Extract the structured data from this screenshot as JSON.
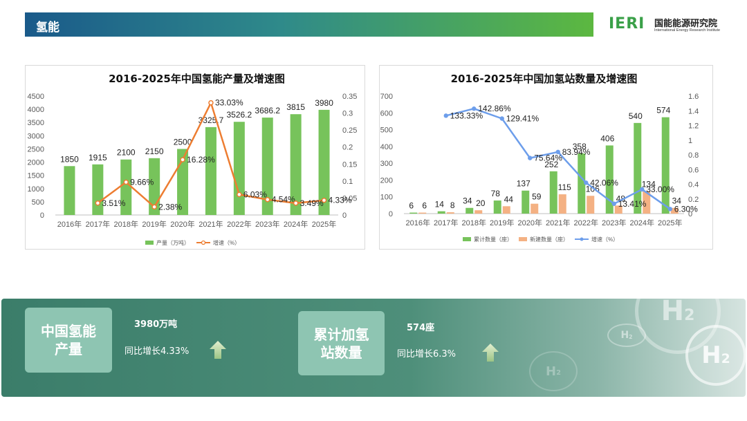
{
  "header": {
    "title": "氢能"
  },
  "logo": {
    "mark": "IERI",
    "name_cn": "国能能源研究院",
    "name_en": "International Energy Research Institute"
  },
  "colors": {
    "green": "#77c35b",
    "orange": "#ed7d31",
    "peach": "#f4b183",
    "blue": "#6d9eeb",
    "axis_text": "#595959",
    "grid": "#e6e6e6"
  },
  "chart_data": [
    {
      "type": "bar",
      "title": "2016-2025年中国氢能产量及增速图",
      "categories": [
        "2016年",
        "2017年",
        "2018年",
        "2019年",
        "2020年",
        "2021年",
        "2022年",
        "2023年",
        "2024年",
        "2025年"
      ],
      "series": [
        {
          "name": "产量（万吨）",
          "type": "bar",
          "axis": "left",
          "values": [
            1850,
            1915,
            2100,
            2150,
            2500,
            3325.7,
            3526.2,
            3686.2,
            3815,
            3980
          ],
          "labels": [
            "1850",
            "1915",
            "2100",
            "2150",
            "2500",
            "3325.7",
            "3526.2",
            "3686.2",
            "3815",
            "3980"
          ]
        },
        {
          "name": "增速（%）",
          "type": "line",
          "axis": "right",
          "values": [
            null,
            0.0351,
            0.0966,
            0.0238,
            0.1628,
            0.3303,
            0.0603,
            0.0454,
            0.0349,
            0.0433
          ],
          "labels": [
            "",
            "3.51%",
            "9.66%",
            "2.38%",
            "16.28%",
            "33.03%",
            "6.03%",
            "4.54%",
            "3.49%",
            "4.33%"
          ]
        }
      ],
      "ylim": [
        0,
        4500
      ],
      "y_ticks": [
        0,
        500,
        1000,
        1500,
        2000,
        2500,
        3000,
        3500,
        4000,
        4500
      ],
      "y2lim": [
        0,
        0.35
      ],
      "y2_ticks": [
        0,
        0.05,
        0.1,
        0.15,
        0.2,
        0.25,
        0.3,
        0.35
      ],
      "y2_tick_labels": [
        "0",
        "0.05",
        "0.1",
        "0.15",
        "0.2",
        "0.25",
        "0.3",
        "0.35"
      ],
      "legend": "bottom",
      "grid": false
    },
    {
      "type": "bar",
      "title": "2016-2025年中国加氢站数量及增速图",
      "categories": [
        "2016年",
        "2017年",
        "2018年",
        "2019年",
        "2020年",
        "2021年",
        "2022年",
        "2023年",
        "2024年",
        "2025年"
      ],
      "series": [
        {
          "name": "累计数量（座）",
          "type": "bar",
          "axis": "left",
          "values": [
            6,
            14,
            34,
            78,
            137,
            252,
            358,
            406,
            540,
            574
          ],
          "labels": [
            "6",
            "14",
            "34",
            "78",
            "137",
            "252",
            "358",
            "406",
            "540",
            "574"
          ]
        },
        {
          "name": "新建数量（座）",
          "type": "bar",
          "axis": "left",
          "values": [
            6,
            8,
            20,
            44,
            59,
            115,
            106,
            48,
            134,
            34
          ],
          "labels": [
            "6",
            "8",
            "20",
            "44",
            "59",
            "115",
            "106",
            "48",
            "134",
            "34"
          ]
        },
        {
          "name": "增速（%）",
          "type": "line",
          "axis": "right",
          "values": [
            null,
            1.3333,
            1.4286,
            1.2941,
            0.7564,
            0.8394,
            0.4206,
            0.1341,
            0.33,
            0.063
          ],
          "labels": [
            "",
            "133.33%",
            "142.86%",
            "129.41%",
            "75.64%",
            "83.94%",
            "42.06%",
            "13.41%",
            "33.00%",
            "6.30%"
          ]
        }
      ],
      "ylim": [
        0,
        700
      ],
      "y_ticks": [
        0,
        100,
        200,
        300,
        400,
        500,
        600,
        700
      ],
      "y2lim": [
        0,
        1.6
      ],
      "y2_ticks": [
        0,
        0.2,
        0.4,
        0.6,
        0.8,
        1,
        1.2,
        1.4,
        1.6
      ],
      "y2_tick_labels": [
        "0",
        "0.2",
        "0.4",
        "0.6",
        "0.8",
        "1",
        "1.2",
        "1.4",
        "1.6"
      ],
      "legend": "bottom",
      "grid": false
    }
  ],
  "summary": {
    "production": {
      "box_label_line1": "中国氢能",
      "box_label_line2": "产量",
      "value": "3980万吨",
      "growth": "同比增长4.33%"
    },
    "stations": {
      "box_label_line1": "累计加氢",
      "box_label_line2": "站数量",
      "value": "574座",
      "growth": "同比增长6.3%"
    }
  },
  "decor": {
    "bubble_icon": "h2-molecule-icon",
    "bubble_text": "H",
    "bubble_sub": "2"
  }
}
